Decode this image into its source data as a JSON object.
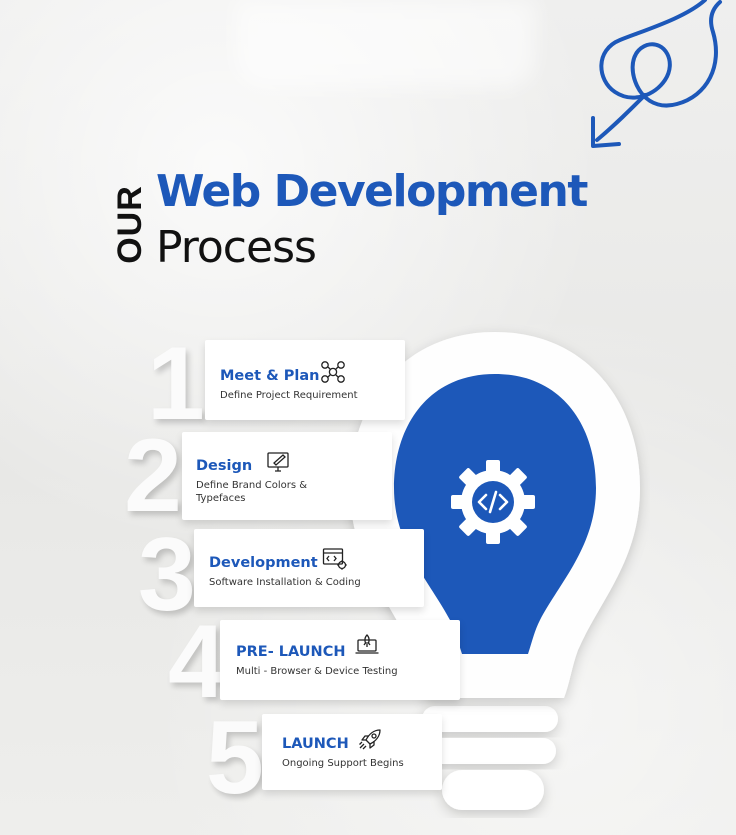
{
  "heading": {
    "prefix": "OUR",
    "main": "Web Development",
    "sub": "Process"
  },
  "colors": {
    "accent": "#1d58b9",
    "text": "#111111",
    "card": "#ffffff",
    "background": "#ececea"
  },
  "center_icon": "code-gear-icon",
  "steps": [
    {
      "number": "1",
      "title": "Meet & Plan",
      "desc_lines": [
        "Define Project Requirement"
      ],
      "icon": "network-nodes-icon"
    },
    {
      "number": "2",
      "title": "Design",
      "desc_lines": [
        "Define Brand Colors &",
        "Typefaces"
      ],
      "icon": "design-monitor-icon"
    },
    {
      "number": "3",
      "title": "Development",
      "desc_lines": [
        "Software Installation & Coding"
      ],
      "icon": "code-window-icon"
    },
    {
      "number": "4",
      "title": "PRE- LAUNCH",
      "desc_lines": [
        "Multi - Browser & Device Testing"
      ],
      "icon": "laptop-rocket-icon"
    },
    {
      "number": "5",
      "title": "LAUNCH",
      "desc_lines": [
        "Ongoing Support Begins"
      ],
      "icon": "rocket-icon"
    }
  ]
}
